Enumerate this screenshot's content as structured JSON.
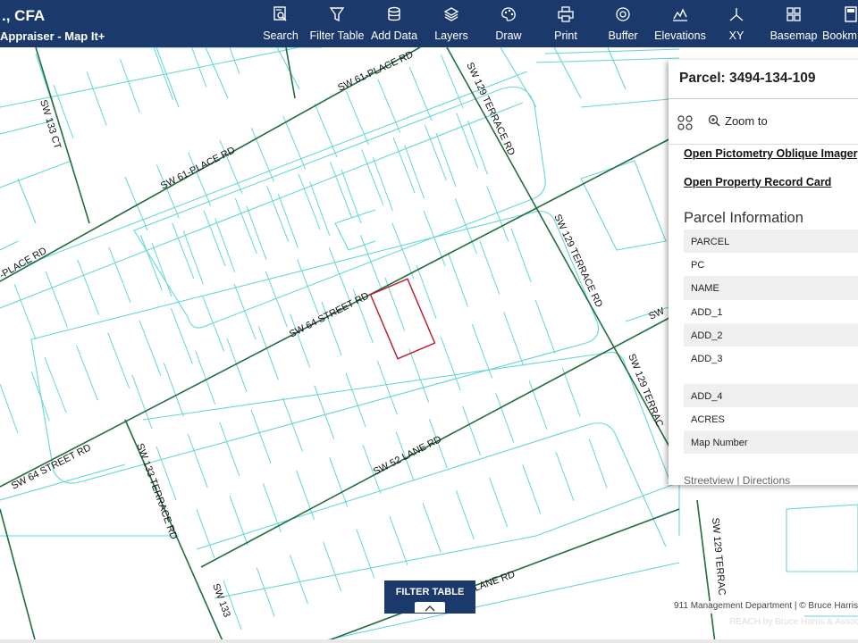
{
  "app": {
    "title_line1": "., CFA",
    "title_line2": "Appraiser - Map It+"
  },
  "toolbar": [
    {
      "label": "Search",
      "icon": "search-icon"
    },
    {
      "label": "Filter Table",
      "icon": "filter-icon"
    },
    {
      "label": "Add Data",
      "icon": "database-icon"
    },
    {
      "label": "Layers",
      "icon": "layers-icon"
    },
    {
      "label": "Draw",
      "icon": "palette-icon"
    },
    {
      "label": "Print",
      "icon": "printer-icon"
    },
    {
      "label": "Buffer",
      "icon": "buffer-icon"
    },
    {
      "label": "Elevations",
      "icon": "elevation-chart-icon"
    },
    {
      "label": "XY",
      "icon": "xy-axes-icon"
    },
    {
      "label": "Basemap",
      "icon": "basemap-grid-icon"
    },
    {
      "label": "Bookm",
      "icon": "bookmark-icon"
    }
  ],
  "map": {
    "road_labels": [
      "SW 61-PLACE RD",
      "SW 61-PLACE RD",
      "-PLACE RD",
      "SW 133 CT",
      "SW 129 TERRACE RD",
      "SW 129 TERRACE RD",
      "SW 129 TERRAC",
      "SW 64 STREET RD",
      "SW 64 STREET RD",
      "SW 52 LANE RD",
      "LANE RD",
      "SW 133 TERRACE RD",
      "SW 133",
      "SW 129 TERRAC",
      "SW"
    ],
    "parcel_color": "#66d6d6",
    "road_color": "#1f6e3c",
    "selected_color": "#c0152a"
  },
  "panel": {
    "title": "Parcel: 3494-134-109",
    "zoom_label": "Zoom to",
    "links": [
      "Open Pictometry Oblique Imagery",
      "Open Property Record Card"
    ],
    "section_title": "Parcel Information",
    "fields": [
      "PARCEL",
      "PC",
      "NAME",
      "ADD_1",
      "ADD_2",
      "ADD_3",
      "ADD_4",
      "ACRES",
      "Map Number"
    ],
    "bottom_links": "Streetview | Directions"
  },
  "filter_tab": {
    "label": "FILTER TABLE"
  },
  "attribution": {
    "line1": "911 Management Department | © Bruce Harris",
    "line2": "REACH by Bruce Harris & Associates"
  }
}
